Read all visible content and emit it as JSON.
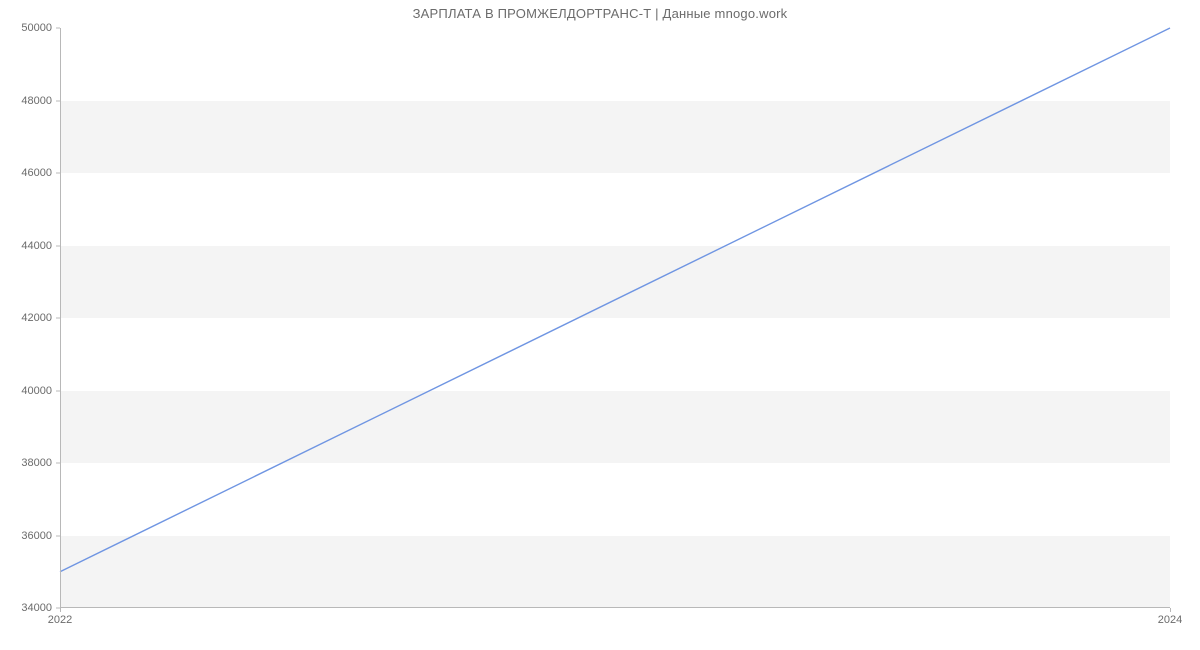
{
  "chart_data": {
    "type": "line",
    "title": "ЗАРПЛАТА В ПРОМЖЕЛДОРТРАНС-Т | Данные mnogo.work",
    "xlabel": "",
    "ylabel": "",
    "x": [
      2022,
      2024
    ],
    "values": [
      35000,
      50000
    ],
    "xlim": [
      2022,
      2024
    ],
    "ylim": [
      34000,
      50000
    ],
    "y_ticks": [
      34000,
      36000,
      38000,
      40000,
      42000,
      44000,
      46000,
      48000,
      50000
    ],
    "x_ticks": [
      2022,
      2024
    ],
    "line_color": "#6f95e2",
    "band_color": "#f4f4f4"
  }
}
